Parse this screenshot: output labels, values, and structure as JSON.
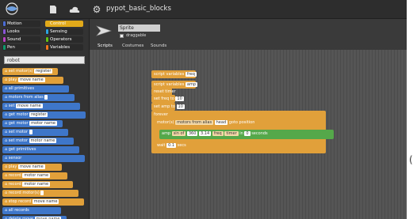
{
  "app": {
    "title": "pypot_basic_blocks"
  },
  "categories": [
    {
      "label": "Motion",
      "color": "#4a6cd4",
      "active": false
    },
    {
      "label": "Looks",
      "color": "#8a55d7",
      "active": false
    },
    {
      "label": "Sound",
      "color": "#bb42c3",
      "active": false
    },
    {
      "label": "Pen",
      "color": "#0e9a6c",
      "active": false
    },
    {
      "label": "Control",
      "color": "#e1a91a",
      "active": true
    },
    {
      "label": "Sensing",
      "color": "#2ca5e2",
      "active": false
    },
    {
      "label": "Operators",
      "color": "#62c213",
      "active": false
    },
    {
      "label": "Variables",
      "color": "#f3761d",
      "active": false
    }
  ],
  "search": {
    "value": "robot"
  },
  "palette_blocks": [
    {
      "text": "set motor(s)",
      "slot": "register",
      "color": "orange"
    },
    {
      "text": "play",
      "slot": "move name",
      "color": "orange"
    },
    {
      "text": "all primitives",
      "color": "blue"
    },
    {
      "text": "motors from alias",
      "slot": "",
      "color": "blue"
    },
    {
      "text": "set",
      "slot": "move name",
      "color": "blue"
    },
    {
      "text": "get motor",
      "slot": "register",
      "color": "blue"
    },
    {
      "text": "get motor",
      "slot": "motor name",
      "color": "blue"
    },
    {
      "text": "set motor",
      "slot": "",
      "color": "blue"
    },
    {
      "text": "set motor",
      "slot": "motor name",
      "color": "blue"
    },
    {
      "text": "get primitives",
      "color": "blue"
    },
    {
      "text": "sensor",
      "color": "blue"
    },
    {
      "text": "play",
      "slot": "move name",
      "color": "orange"
    },
    {
      "text": "record",
      "slot": "motor name",
      "color": "orange"
    },
    {
      "text": "record",
      "slot": "motor name",
      "color": "orange"
    },
    {
      "text": "record motor(s)",
      "slot": "",
      "color": "orange"
    },
    {
      "text": "stop record",
      "slot": "move name",
      "color": "orange"
    },
    {
      "text": "all records",
      "color": "blue"
    },
    {
      "text": "delete move",
      "slot": "move name",
      "color": "blue"
    }
  ],
  "sprite": {
    "name": "Sprite",
    "draggable_label": "draggable"
  },
  "tabs": [
    "Scripts",
    "Costumes",
    "Sounds"
  ],
  "script": {
    "lines": [
      {
        "text": "script variables",
        "slot": "freq",
        "color": "orange"
      },
      {
        "text": "script variables",
        "slot": "amp",
        "color": "orange"
      },
      {
        "text": "reset timer",
        "color": "orange"
      },
      {
        "text": "set freq to",
        "slot": "10",
        "color": "orange"
      },
      {
        "text": "set amp to",
        "slot": "10",
        "color": "orange"
      },
      {
        "text": "forever",
        "color": "orange"
      },
      {
        "text": "motor(s)",
        "mid": "motors from alias",
        "slot": "head",
        "end": "goto position",
        "color": "orange"
      },
      {
        "text": "amp",
        "mid": "sin of",
        "slot": "360",
        "extra": "3.14",
        "tail": "freq",
        "tail2": "timer",
        "end": "in",
        "end_slot": "0",
        "end2": "seconds",
        "color": "green"
      },
      {
        "text": "wait",
        "slot": "0.1",
        "end": "secs",
        "color": "orange"
      }
    ]
  },
  "right_glyph": "("
}
